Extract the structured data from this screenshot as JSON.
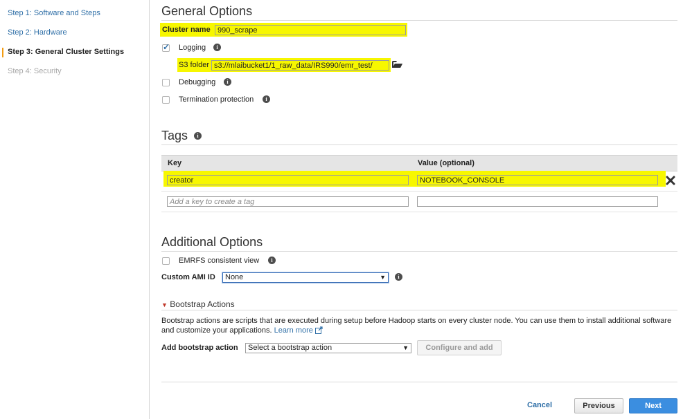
{
  "sidebar": {
    "steps": [
      {
        "label": "Step 1: Software and Steps",
        "state": "link"
      },
      {
        "label": "Step 2: Hardware",
        "state": "link"
      },
      {
        "label": "Step 3: General Cluster Settings",
        "state": "current"
      },
      {
        "label": "Step 4: Security",
        "state": "disabled"
      }
    ]
  },
  "general_options": {
    "title": "General Options",
    "cluster_name_label": "Cluster name",
    "cluster_name_value": "990_scrape",
    "logging_label": "Logging",
    "logging_checked": true,
    "s3_folder_label": "S3 folder",
    "s3_folder_value": "s3://mlaibucket1/1_raw_data/IRS990/emr_test/",
    "debugging_label": "Debugging",
    "debugging_checked": false,
    "termination_label": "Termination protection",
    "termination_checked": false
  },
  "tags": {
    "title": "Tags",
    "col_key": "Key",
    "col_value": "Value (optional)",
    "rows": [
      {
        "key": "creator",
        "value": "NOTEBOOK_CONSOLE"
      }
    ],
    "new_key_placeholder": "Add a key to create a tag",
    "new_value_placeholder": ""
  },
  "additional_options": {
    "title": "Additional Options",
    "emrfs_label": "EMRFS consistent view",
    "emrfs_checked": false,
    "ami_label": "Custom AMI ID",
    "ami_value": "None"
  },
  "bootstrap": {
    "title": "Bootstrap Actions",
    "description": "Bootstrap actions are scripts that are executed during setup before Hadoop starts on every cluster node. You can use them to install additional software and customize your applications.",
    "learn_more": "Learn more",
    "add_label": "Add bootstrap action",
    "select_value": "Select a bootstrap action",
    "configure_button": "Configure and add"
  },
  "footer": {
    "cancel": "Cancel",
    "previous": "Previous",
    "next": "Next"
  },
  "colors": {
    "highlight": "#f7f700",
    "link": "#2f6fa7",
    "primary": "#3b8ee0"
  }
}
